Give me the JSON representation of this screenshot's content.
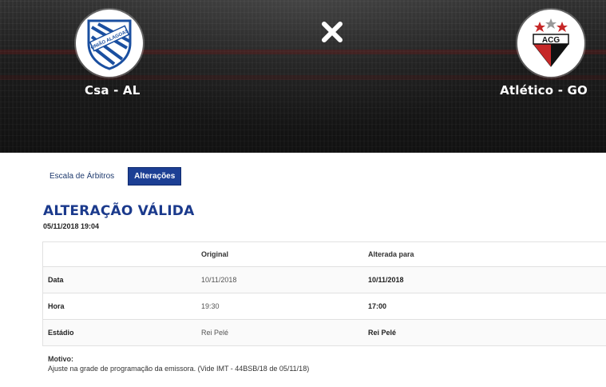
{
  "match": {
    "home_team": "Csa - AL",
    "away_team": "Atlético - GO",
    "versus_icon": "close-x-icon",
    "home_crest_icon": "csa-crest-icon",
    "away_crest_icon": "acg-crest-icon",
    "away_crest_letters": "ACG",
    "home_crest_text": "UNIÃO ALAGOAS"
  },
  "tabs": [
    {
      "label": "Escala de Árbitros",
      "active": false
    },
    {
      "label": "Alterações",
      "active": true
    }
  ],
  "status": {
    "title": "ALTERAÇÃO VÁLIDA",
    "datetime": "05/11/2018 19:04"
  },
  "table": {
    "headers": [
      "",
      "Original",
      "Alterada para"
    ],
    "rows": [
      {
        "field": "Data",
        "original": "10/11/2018",
        "changed": "10/11/2018"
      },
      {
        "field": "Hora",
        "original": "19:30",
        "changed": "17:00"
      },
      {
        "field": "Estádio",
        "original": "Rei Pelé",
        "changed": "Rei Pelé"
      }
    ]
  },
  "motivo": {
    "label": "Motivo:",
    "text": "Ajuste na grade de programação da emissora. (Vide IMT - 44BSB/18 de 05/11/18)"
  },
  "colors": {
    "accent": "#1c3f94",
    "title": "#1b3a8c"
  }
}
